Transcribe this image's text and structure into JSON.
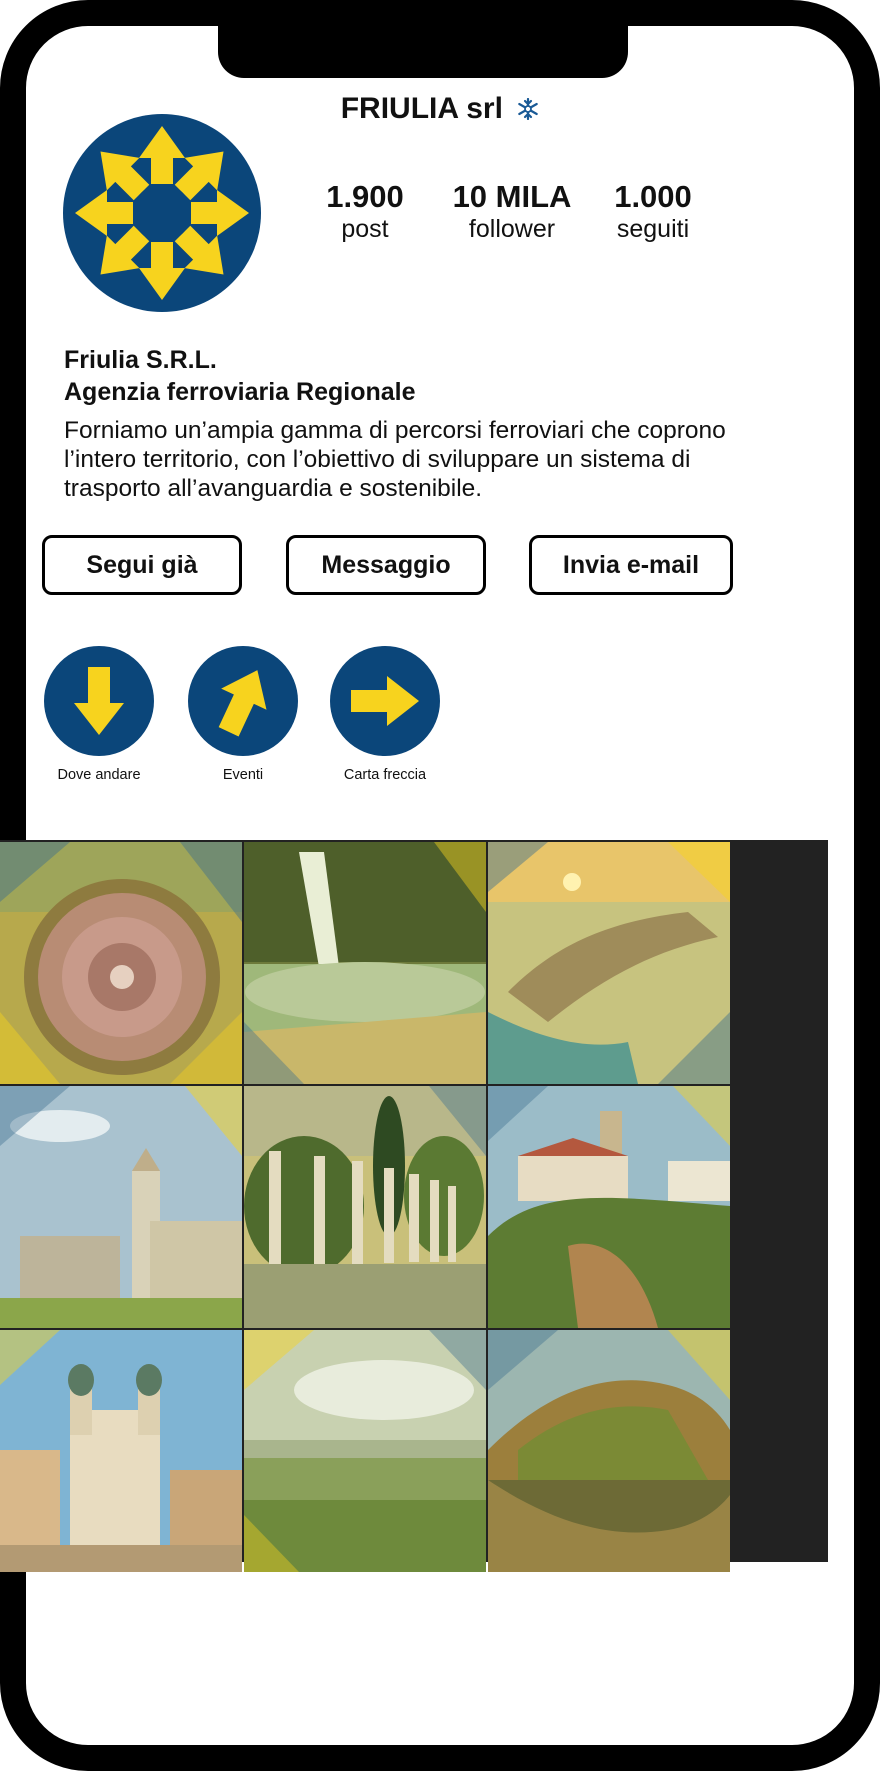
{
  "profile": {
    "username": "FRIULIA srl",
    "display_name": "Friulia S.R.L.",
    "category": "Agenzia ferroviaria Regionale",
    "bio": "Forniamo un’ampia gamma di percorsi ferroviari che coprono l’intero territorio, con l’obiettivo di sviluppare un sistema di trasporto all’avanguardia e sostenibile.",
    "verified_icon": "snowflake-icon",
    "avatar_icon": "arrow-star-logo"
  },
  "stats": {
    "posts": {
      "value": "1.900",
      "label": "post"
    },
    "followers": {
      "value": "10 MILA",
      "label": "follower"
    },
    "following": {
      "value": "1.000",
      "label": "seguiti"
    }
  },
  "actions": {
    "follow": "Segui già",
    "message": "Messaggio",
    "email": "Invia e-mail"
  },
  "highlights": [
    {
      "label": "Dove andare",
      "icon": "arrow-down-icon"
    },
    {
      "label": "Eventi",
      "icon": "arrow-up-right-icon"
    },
    {
      "label": "Carta freccia",
      "icon": "arrow-right-icon"
    }
  ],
  "posts": [
    {
      "subject": "star-fortress-town"
    },
    {
      "subject": "waterfall"
    },
    {
      "subject": "lagoon-sunset"
    },
    {
      "subject": "basilica-bell-tower"
    },
    {
      "subject": "roman-columns"
    },
    {
      "subject": "hill-castle"
    },
    {
      "subject": "baroque-church"
    },
    {
      "subject": "countryside-panorama"
    },
    {
      "subject": "lake-mountain"
    }
  ],
  "colors": {
    "brand_blue": "#0b467a",
    "brand_yellow": "#f7d31e",
    "frame": "#000000"
  }
}
